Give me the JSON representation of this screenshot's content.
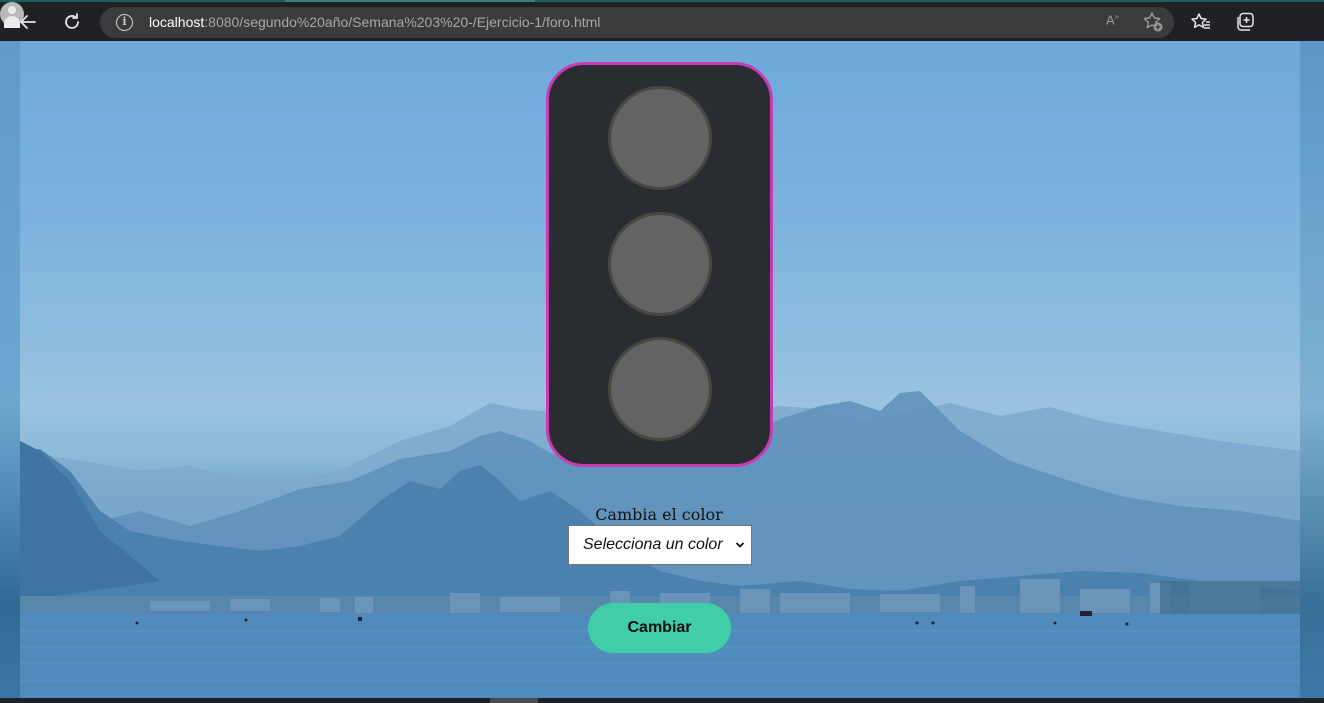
{
  "browser": {
    "url_host": "localhost",
    "url_rest": ":8080/segundo%20año/Semana%203%20-/Ejercicio-1/foro.html",
    "read_aloud": "Ȃ",
    "icons": [
      "back-arrow-icon",
      "reload-icon",
      "site-info-icon",
      "read-aloud-icon",
      "add-favorite-icon",
      "favorites-icon",
      "collections-icon",
      "profile-avatar"
    ]
  },
  "traffic_light": {
    "border_color": "#c93bb5",
    "body_color": "#292c31",
    "lamps": [
      {
        "state": "off",
        "color": "#636363"
      },
      {
        "state": "off",
        "color": "#636363"
      },
      {
        "state": "off",
        "color": "#636363"
      }
    ]
  },
  "form": {
    "label": "Cambia el color",
    "select_value": "Selecciona un color",
    "button_label": "Cambiar",
    "button_color": "#3fcea8"
  }
}
